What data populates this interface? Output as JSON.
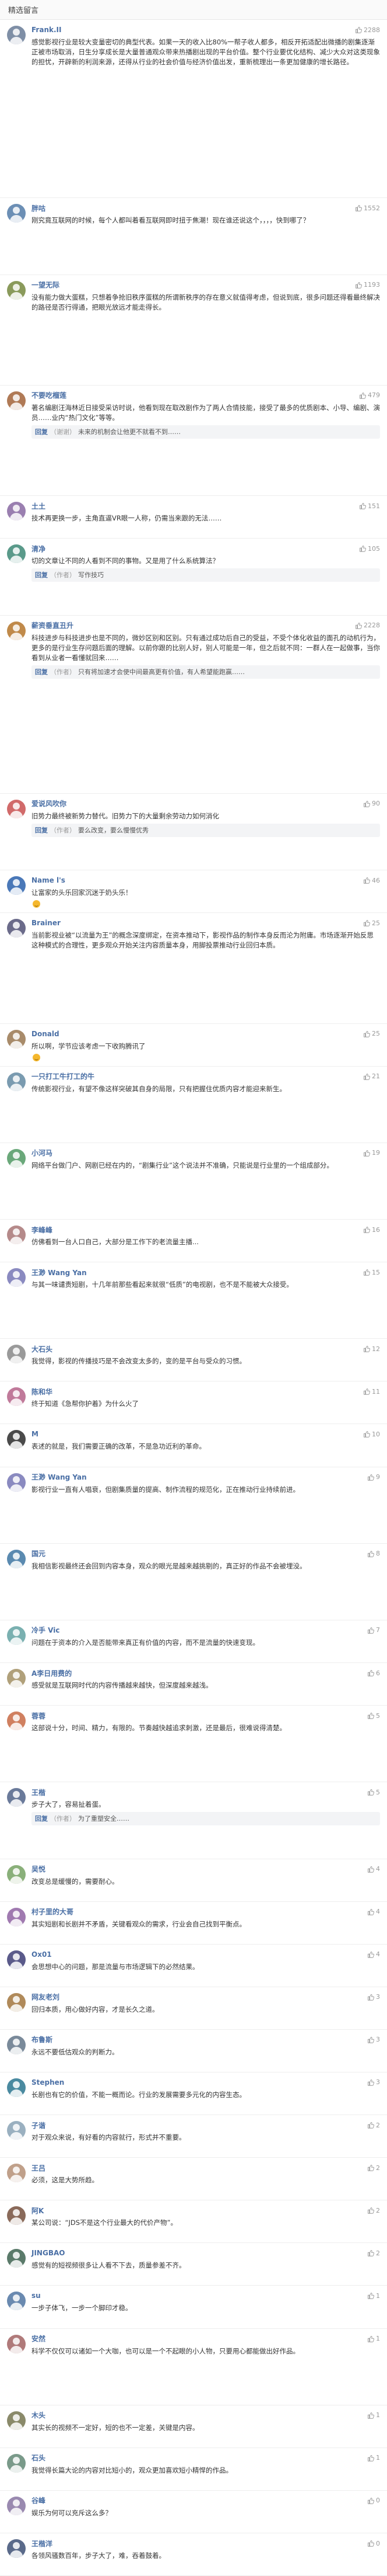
{
  "header": {
    "title": "精选留言"
  },
  "like_icon": "thumbs-up-icon",
  "comments": [
    {
      "author": "Frank.II",
      "likes": "2288",
      "avatar_color": "#7f8fa6",
      "text": "感觉影视行业是较大变量密切的典型代表。如果一天的收入比80%一帮子收人都多，相反开拓适配出微播的剧集逐渐正被市场取消，日生分享成长是大量普通观众带来热播剧出现的平台价值。整个行业要优化结构、减少大众对这类现象的担忧，开辟新的利润来源，还得从行业的社会价值与经济价值出发，重新梳理出一条更加健康的增长路径。"
    },
    {
      "author": "胖咕",
      "likes": "1552",
      "avatar_color": "#6c8fb5",
      "text": "刚究竟互联网的时候，每个人都叫着看互联网即时扭于焦潮！现在谁还说这个，，，，快到哪了？"
    },
    {
      "author": "一望无际",
      "likes": "1193",
      "avatar_color": "#8a9a5b",
      "text": "没有能力做大蛋糕，只想着争抢旧秩序蛋糕的所谓新秩序的存在意义就值得考虑，但说到底，很多问题还得看最终解决的路径是否行得通，把眼光放远才能走得长。"
    },
    {
      "author": "不要吃榴莲",
      "likes": "479",
      "avatar_color": "#b07a56",
      "text": "著名编剧汪海林近日接受采访时说，他看到现在取改剧作为了两人合情技能，接受了最多的优质剧本、小导、编剧、演员……业内“热门文化”等等。",
      "reply": {
        "author": "回复",
        "badge": "（谢谢）",
        "text": "未来的机制会让他更不就看不到……"
      }
    },
    {
      "author": "土土",
      "likes": "151",
      "avatar_color": "#9a7fb0",
      "text": "技术再更换一步，主角直逼VR眼一人称，仍需当来跟的无法……"
    },
    {
      "author": "清净",
      "likes": "105",
      "avatar_color": "#5a9a8a",
      "text": "切的文章让不同的人看到不同的事物。又是用了什么系统算法？",
      "reply": {
        "author": "回复",
        "badge": "（作者）",
        "text": "写作技巧"
      }
    },
    {
      "author": "薪资垂直丑升",
      "likes": "2228",
      "avatar_color": "#c08a4a",
      "text": "科技进步与科技进步也是不同的，微妙区别和区别。只有通过成功后自己的受益，不受个体化收益的面孔的动机行为，更多的是行业生存问题后面的理解。以前你跟的比别人好，别人可能是一年，但之后就不同：一群人在一起做事，当你看到从业者一看懂就回来……",
      "reply": {
        "author": "回复",
        "badge": "（作者）",
        "text": "只有将加速才会使中间最高更有价值，有人希望能跑赢……"
      }
    },
    {
      "author": "爱说风吹你",
      "likes": "90",
      "avatar_color": "#d16a6a",
      "text": "旧势力最终被新势力替代。旧势力下的大量剩余劳动力如何消化",
      "reply": {
        "author": "回复",
        "badge": "（作者）",
        "text": "要么改变，要么慢慢优秀"
      }
    },
    {
      "author": "Name l's",
      "likes": "46",
      "avatar_color": "#4a78b8",
      "text": "让富家的头乐回家沉迷于奶头乐！",
      "emoji": true
    },
    {
      "author": "Brainer",
      "likes": "25",
      "avatar_color": "#6b6b8a",
      "text": "当前影视业被“以流量为王”的概念深度绑定，在资本推动下，影视作品的制作本身反而沦为附庸。市场逐渐开始反思这种模式的合理性，更多观众开始关注内容质量本身，用脚投票推动行业回归本质。"
    },
    {
      "author": "Donald",
      "likes": "25",
      "avatar_color": "#a88b6a",
      "text": "所以啊，学节应该考虑一下收购腾讯了",
      "emoji": true
    },
    {
      "author": "一只打工牛打工的牛",
      "likes": "21",
      "avatar_color": "#7a9bb0",
      "text": "传统影视行业，有望不像这样突破其自身的局限，只有把握住优质内容才能迎来新生。"
    },
    {
      "author": "小河马",
      "likes": "19",
      "avatar_color": "#6aa87a",
      "text": "网络平台做门户、网剧已经在内的，“剧集行业”这个说法并不准确，只能说是行业里的一个组成部分。"
    },
    {
      "author": "李峰峰",
      "likes": "16",
      "avatar_color": "#b58a8a",
      "text": "仿佛看到一台人口自己，大部分是工作下的老流量主播..."
    },
    {
      "author": "王渺 Wang Yan",
      "likes": "15",
      "avatar_color": "#8a8ac0",
      "text": "与其一味谴责短剧，十几年前那些看起来就很“低质”的电视剧，也不是不能被大众接受。"
    },
    {
      "author": "大石头",
      "likes": "12",
      "avatar_color": "#9a9a9a",
      "text": "我觉得，影视的传播技巧是不会改变太多的，变的是平台与受众的习惯。"
    },
    {
      "author": "陈和华",
      "likes": "11",
      "avatar_color": "#c07a9a",
      "text": "终于知道《急帮你护着》为什么火了"
    },
    {
      "author": "M",
      "likes": "10",
      "avatar_color": "#4a4a4a",
      "text": "表述的就是，我们需要正确的改革，不是急功近利的革命。"
    },
    {
      "author": "王渺 Wang Yan",
      "likes": "9",
      "avatar_color": "#8a8ac0",
      "text": "影视行业一直有人唱衰，但剧集质量的提高、制作流程的规范化，正在推动行业持续前进。"
    },
    {
      "author": "国元",
      "likes": "8",
      "avatar_color": "#5a8ab0",
      "text": "我相信影视最终还会回到内容本身，观众的眼光是越来越挑剔的，真正好的作品不会被埋没。"
    },
    {
      "author": "冷手 Vic",
      "likes": "7",
      "avatar_color": "#7ab0b0",
      "text": "问题在于资本的介入是否能带来真正有价值的内容，而不是流量的快速变现。"
    },
    {
      "author": "A李日用费的",
      "likes": "6",
      "avatar_color": "#b0a07a",
      "text": "感受就是互联网时代的内容传播越来越快，但深度越来越浅。"
    },
    {
      "author": "蓉蓉",
      "likes": "5",
      "avatar_color": "#d08060",
      "text": "这部说十分，时间、精力，有限的。节奏越快越追求刺激，还是最后，很难说得清楚。"
    },
    {
      "author": "王楷",
      "likes": "5",
      "avatar_color": "#6a7a9a",
      "text": "步子大了，容易扯着蛋。",
      "reply": {
        "author": "回复",
        "badge": "（作者）",
        "text": "为了重塑安全……"
      }
    },
    {
      "author": "吴悦",
      "likes": "4",
      "avatar_color": "#8ab07a",
      "text": "改变总是缓慢的，需要耐心。"
    },
    {
      "author": "村子里的大哥",
      "likes": "4",
      "avatar_color": "#a07ab0",
      "text": "其实短剧和长剧并不矛盾，关键看观众的需求，行业会自己找到平衡点。"
    },
    {
      "author": "Ox01",
      "likes": "4",
      "avatar_color": "#5a5a8a",
      "text": "会思想中心的问题，那是流量与市场逻辑下的必然结果。"
    },
    {
      "author": "网友老刘",
      "likes": "3",
      "avatar_color": "#b08a5a",
      "text": "回归本质，用心做好内容，才是长久之道。"
    },
    {
      "author": "布鲁斯",
      "likes": "3",
      "avatar_color": "#7a8a9a",
      "text": "永远不要低估观众的判断力。"
    },
    {
      "author": "Stephen",
      "likes": "3",
      "avatar_color": "#4a8aa0",
      "text": "长剧也有它的价值，不能一概而论。行业的发展需要多元化的内容生态。"
    },
    {
      "author": "子谐",
      "likes": "2",
      "avatar_color": "#9ab0c0",
      "text": "对于观众来说，有好看的内容就行，形式并不重要。"
    },
    {
      "author": "王吕",
      "likes": "2",
      "avatar_color": "#c0a08a",
      "text": "必须，这是大势所趋。"
    },
    {
      "author": "阿K",
      "likes": "2",
      "avatar_color": "#8a6a5a",
      "text": "某公司说：“JDS不是这个行业最大的代价产物”。"
    },
    {
      "author": "JINGBAO",
      "likes": "2",
      "avatar_color": "#5a7a6a",
      "text": "感觉有的短视频很多让人看不下去，质量参差不齐。"
    },
    {
      "author": "su",
      "likes": "1",
      "avatar_color": "#6a8ab0",
      "text": "一步子体飞，一步一个脚印才稳。"
    },
    {
      "author": "安然",
      "likes": "1",
      "avatar_color": "#b07a7a",
      "text": "科学不仅仅可以诸如一个大咖，也可以是一个不起眼的小人物，只要用心都能做出好作品。"
    },
    {
      "author": "木头",
      "likes": "1",
      "avatar_color": "#8a8a6a",
      "text": "其实长的视频不一定好，短的也不一定差，关键是内容。"
    },
    {
      "author": "石头",
      "likes": "1",
      "avatar_color": "#7a9a8a",
      "text": "我觉得长篇大论的内容对比短小的，观众更加喜欢短小精悍的作品。"
    },
    {
      "author": "谷峰",
      "likes": "0",
      "avatar_color": "#9a8ab0",
      "text": "娱乐为何可以充斥这么多？"
    },
    {
      "author": "王楷洋",
      "likes": "0",
      "avatar_color": "#5a6a8a",
      "text": "各领风骚数百年，步子大了，难，吞着鼓着。"
    }
  ]
}
